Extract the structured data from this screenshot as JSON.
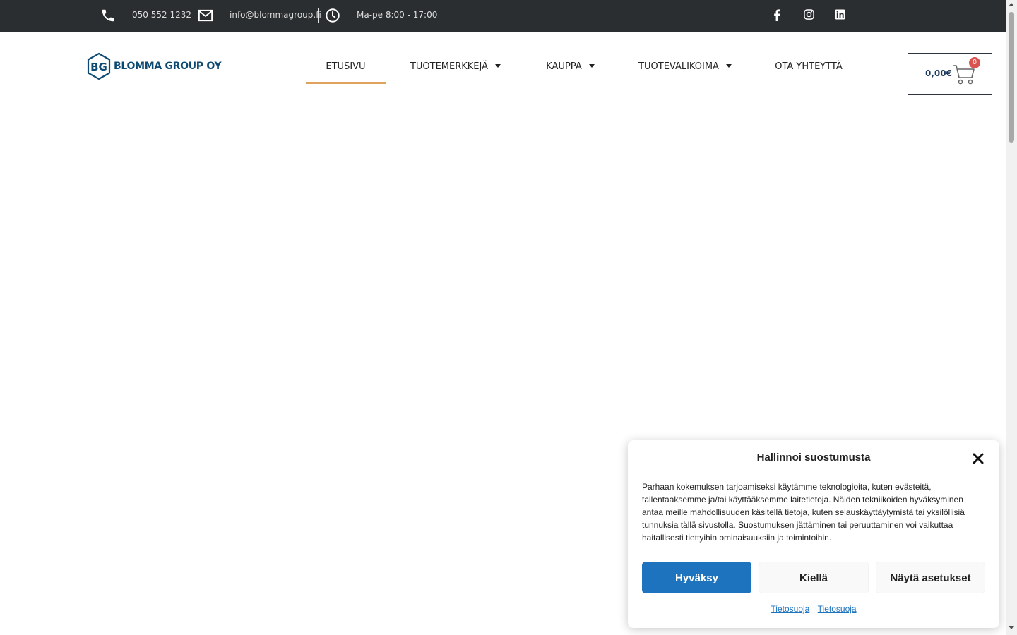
{
  "topbar": {
    "phone": "050 552 1232",
    "email": "info@blommagroup.fi",
    "hours": "Ma-pe 8:00 - 17:00",
    "social": [
      "facebook-icon",
      "instagram-icon",
      "linkedin-icon"
    ]
  },
  "header": {
    "logo_mark": "BG",
    "logo_text": "BLOMMA GROUP OY",
    "nav": [
      {
        "label": "ETUSIVU",
        "active": true,
        "has_dropdown": false
      },
      {
        "label": "TUOTEMERKKEJÄ",
        "active": false,
        "has_dropdown": true
      },
      {
        "label": "KAUPPA",
        "active": false,
        "has_dropdown": true
      },
      {
        "label": "TUOTEVALIKOIMA",
        "active": false,
        "has_dropdown": true
      },
      {
        "label": "OTA YHTEYTTÄ",
        "active": false,
        "has_dropdown": false
      }
    ],
    "cart": {
      "price": "0,00€",
      "count": "0"
    }
  },
  "cookie": {
    "title": "Hallinnoi suostumusta",
    "body": "Parhaan kokemuksen tarjoamiseksi käytämme teknologioita, kuten evästeitä, tallentaaksemme ja/tai käyttääksemme laitetietoja. Näiden tekniikoiden hyväksyminen antaa meille mahdollisuuden käsitellä tietoja, kuten selauskäyttäytymistä tai yksilöllisiä tunnuksia tällä sivustolla. Suostumuksen jättäminen tai peruuttaminen voi vaikuttaa haitallisesti tiettyihin ominaisuuksiin ja toimintoihin.",
    "accept": "Hyväksy",
    "deny": "Kiellä",
    "preferences": "Näytä asetukset",
    "links": [
      "Tietosuoja",
      "Tietosuoja"
    ]
  },
  "colors": {
    "topbar_bg": "#2b2e30",
    "brand": "#0d4a73",
    "nav_active_underline": "#e1a35b",
    "accept_button": "#1e73be",
    "cart_badge": "#d9534f"
  }
}
